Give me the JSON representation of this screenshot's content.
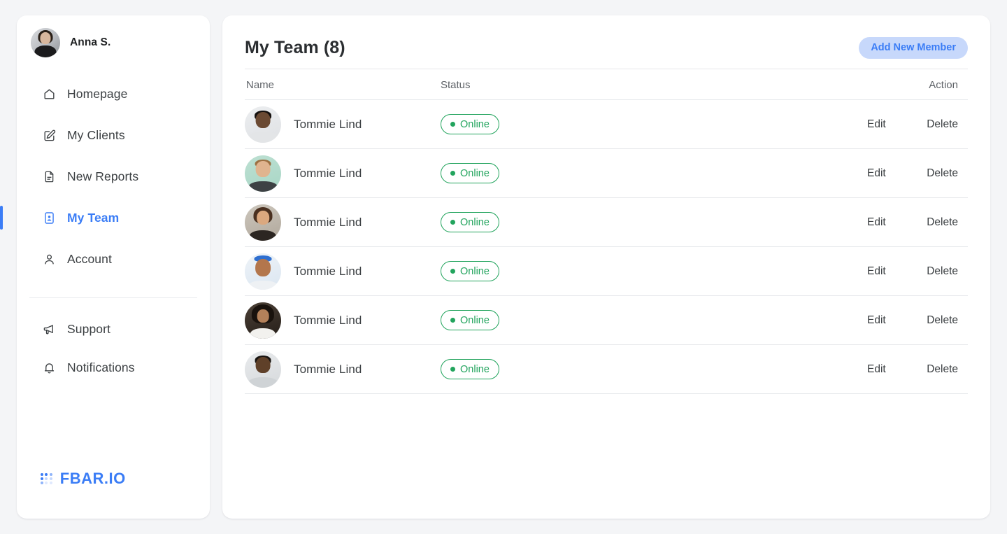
{
  "theme": {
    "page_bg": "#f4f5f7",
    "card_bg": "#ffffff",
    "accent": "#3b7df6",
    "accent_soft": "#c7d8fb",
    "status_green": "#22a45d",
    "text_primary": "#3c4043",
    "text_muted": "#5f6368",
    "border": "#e6e8eb"
  },
  "sidebar": {
    "profile": {
      "name": "Anna S.",
      "avatar_icon": "user-avatar"
    },
    "items": [
      {
        "label": "Homepage",
        "icon": "home-icon",
        "active": false
      },
      {
        "label": "My Clients",
        "icon": "edit-square-icon",
        "active": false
      },
      {
        "label": "New Reports",
        "icon": "document-icon",
        "active": false
      },
      {
        "label": "My Team",
        "icon": "id-card-icon",
        "active": true
      },
      {
        "label": "Account",
        "icon": "person-icon",
        "active": false
      }
    ],
    "bottom_items": [
      {
        "label": "Support",
        "icon": "megaphone-icon"
      },
      {
        "label": "Notifications",
        "icon": "bell-icon"
      }
    ],
    "brand": {
      "text": "FBAR.IO",
      "icon": "dot-grid-icon"
    }
  },
  "main": {
    "title": "My Team (8)",
    "add_button": "Add New Member",
    "columns": {
      "name": "Name",
      "status": "Status",
      "action": "Action"
    },
    "actions": {
      "edit": "Edit",
      "delete": "Delete"
    },
    "rows": [
      {
        "name": "Tommie Lind",
        "status": "Online",
        "avatar": "avatar-1"
      },
      {
        "name": "Tommie Lind",
        "status": "Online",
        "avatar": "avatar-2"
      },
      {
        "name": "Tommie Lind",
        "status": "Online",
        "avatar": "avatar-3"
      },
      {
        "name": "Tommie Lind",
        "status": "Online",
        "avatar": "avatar-4"
      },
      {
        "name": "Tommie Lind",
        "status": "Online",
        "avatar": "avatar-5"
      },
      {
        "name": "Tommie Lind",
        "status": "Online",
        "avatar": "avatar-6"
      }
    ]
  }
}
